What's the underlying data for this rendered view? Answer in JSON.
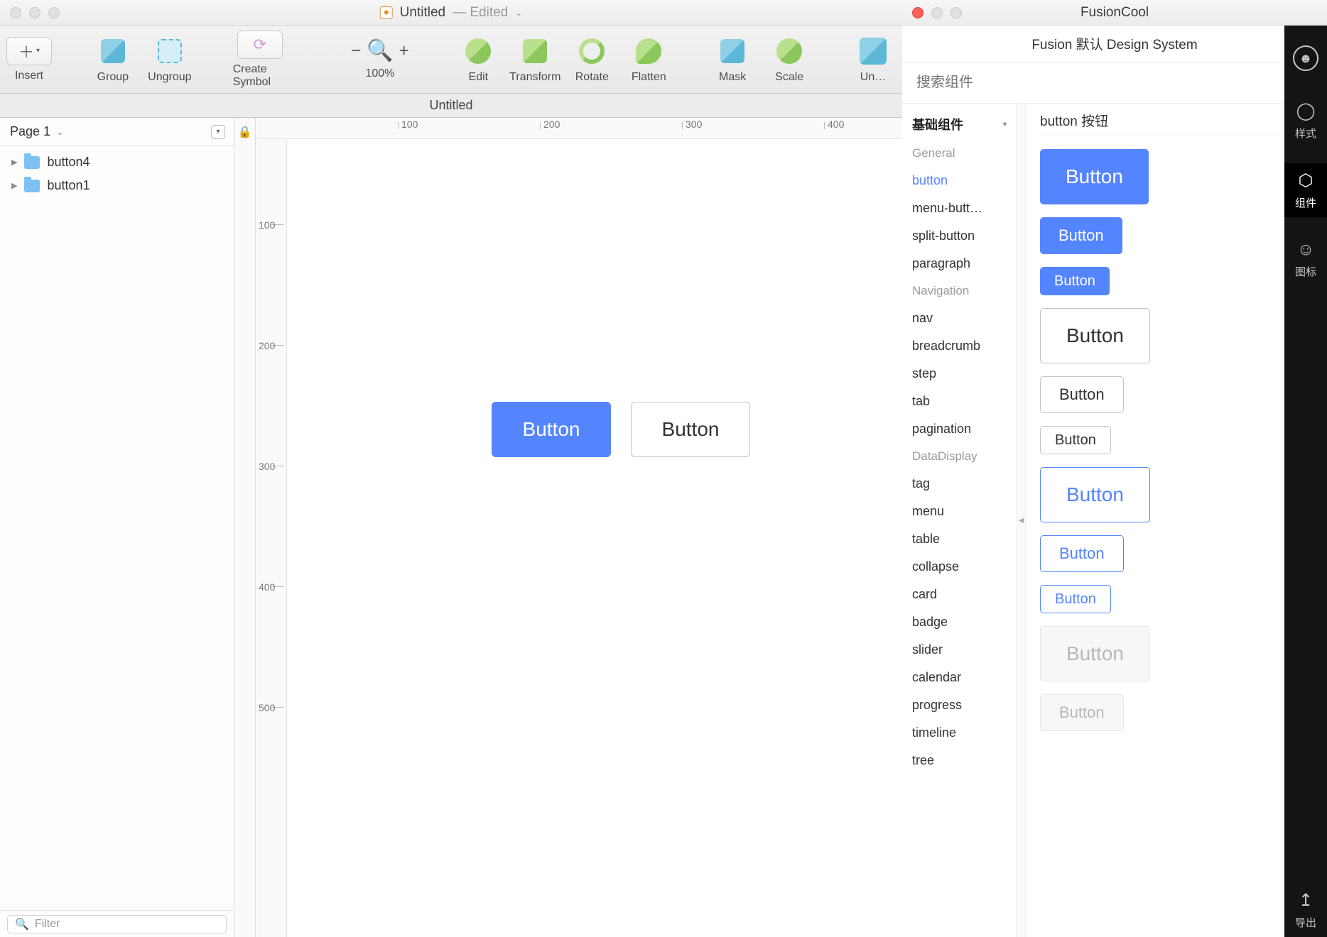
{
  "sketch": {
    "title": "Untitled",
    "edited": "— Edited",
    "doc_tab": "Untitled",
    "toolbar": {
      "insert": "Insert",
      "group": "Group",
      "ungroup": "Ungroup",
      "create_symbol": "Create Symbol",
      "zoom": "100%",
      "edit": "Edit",
      "transform": "Transform",
      "rotate": "Rotate",
      "flatten": "Flatten",
      "mask": "Mask",
      "scale": "Scale",
      "union": "Un…"
    },
    "page_selector": "Page 1",
    "layers": [
      {
        "name": "button4"
      },
      {
        "name": "button1"
      }
    ],
    "filter_placeholder": "Filter",
    "h_ruler": [
      "100",
      "200",
      "300",
      "400"
    ],
    "v_ruler": [
      "100",
      "200",
      "300",
      "400",
      "500"
    ],
    "canvas_buttons": {
      "primary": "Button",
      "secondary": "Button"
    }
  },
  "fusioncool": {
    "app_title": "FusionCool",
    "design_system": "Fusion 默认 Design System",
    "search_placeholder": "搜索组件",
    "cat_header": "基础组件",
    "groups": [
      {
        "group": "General",
        "items": [
          "button",
          "menu-butt…",
          "split-button",
          "paragraph"
        ]
      },
      {
        "group": "Navigation",
        "items": [
          "nav",
          "breadcrumb",
          "step",
          "tab",
          "pagination"
        ]
      },
      {
        "group": "DataDisplay",
        "items": [
          "tag",
          "menu",
          "table",
          "collapse",
          "card",
          "badge",
          "slider",
          "calendar",
          "progress",
          "timeline",
          "tree"
        ]
      }
    ],
    "active_item": "button",
    "preview_title": "button 按钮",
    "previews": [
      {
        "style": "prim",
        "size": "lg",
        "label": "Button"
      },
      {
        "style": "prim",
        "size": "md",
        "label": "Button"
      },
      {
        "style": "prim",
        "size": "sm",
        "label": "Button"
      },
      {
        "style": "norm",
        "size": "lg",
        "label": "Button"
      },
      {
        "style": "norm",
        "size": "md",
        "label": "Button"
      },
      {
        "style": "norm",
        "size": "sm",
        "label": "Button"
      },
      {
        "style": "outline",
        "size": "lg",
        "label": "Button"
      },
      {
        "style": "outline",
        "size": "md",
        "label": "Button"
      },
      {
        "style": "outline",
        "size": "sm",
        "label": "Button"
      },
      {
        "style": "dis",
        "size": "lg",
        "label": "Button"
      },
      {
        "style": "dis",
        "size": "md",
        "label": "Button"
      }
    ]
  },
  "vtabs": {
    "style": "样式",
    "component": "组件",
    "icon": "图标",
    "export": "导出"
  }
}
